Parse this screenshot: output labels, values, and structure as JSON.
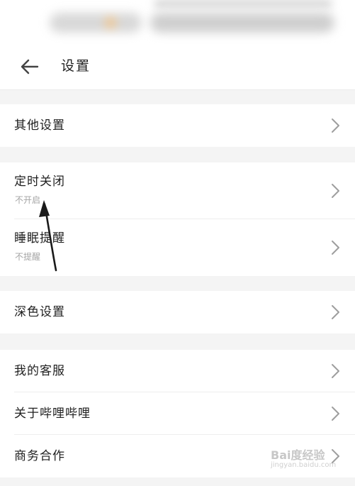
{
  "header": {
    "title": "设置",
    "back_icon": "arrow-left-icon"
  },
  "groups": [
    {
      "items": [
        {
          "label": "其他设置",
          "sublabel": ""
        }
      ]
    },
    {
      "items": [
        {
          "label": "定时关闭",
          "sublabel": "不开启"
        },
        {
          "label": "睡眠提醒",
          "sublabel": "不提醒"
        }
      ]
    },
    {
      "items": [
        {
          "label": "深色设置",
          "sublabel": ""
        }
      ]
    },
    {
      "items": [
        {
          "label": "我的客服",
          "sublabel": ""
        },
        {
          "label": "关于哔哩哔哩",
          "sublabel": ""
        },
        {
          "label": "商务合作",
          "sublabel": ""
        }
      ]
    }
  ],
  "watermark": {
    "logo": "Bai度经验",
    "url": "jingyan.baidu.com"
  },
  "colors": {
    "background": "#f4f4f4",
    "text": "#212121",
    "sublabel": "#a5a5a5",
    "chevron": "#9e9e9e"
  }
}
